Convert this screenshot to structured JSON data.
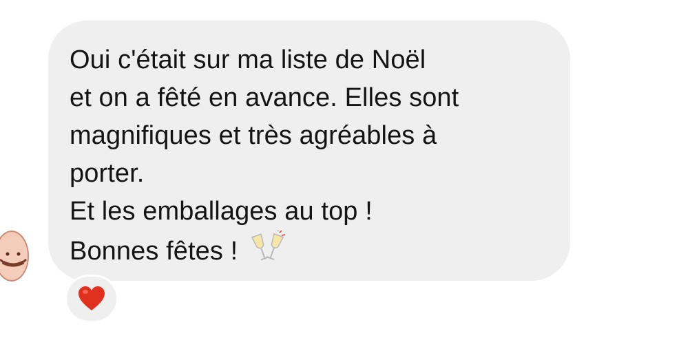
{
  "message": {
    "lines": [
      "Oui c'était sur ma liste de Noël",
      "et on a fêté en avance. Elles sont",
      "magnifiques et très agréables à",
      "porter.",
      "Et les emballages au top !",
      "Bonnes fêtes !"
    ],
    "emoji": "clinking-glasses-icon"
  },
  "reaction": {
    "emoji": "heart-icon"
  },
  "colors": {
    "bubble": "#efefef",
    "text": "#141414",
    "heart": "#e0301e"
  }
}
